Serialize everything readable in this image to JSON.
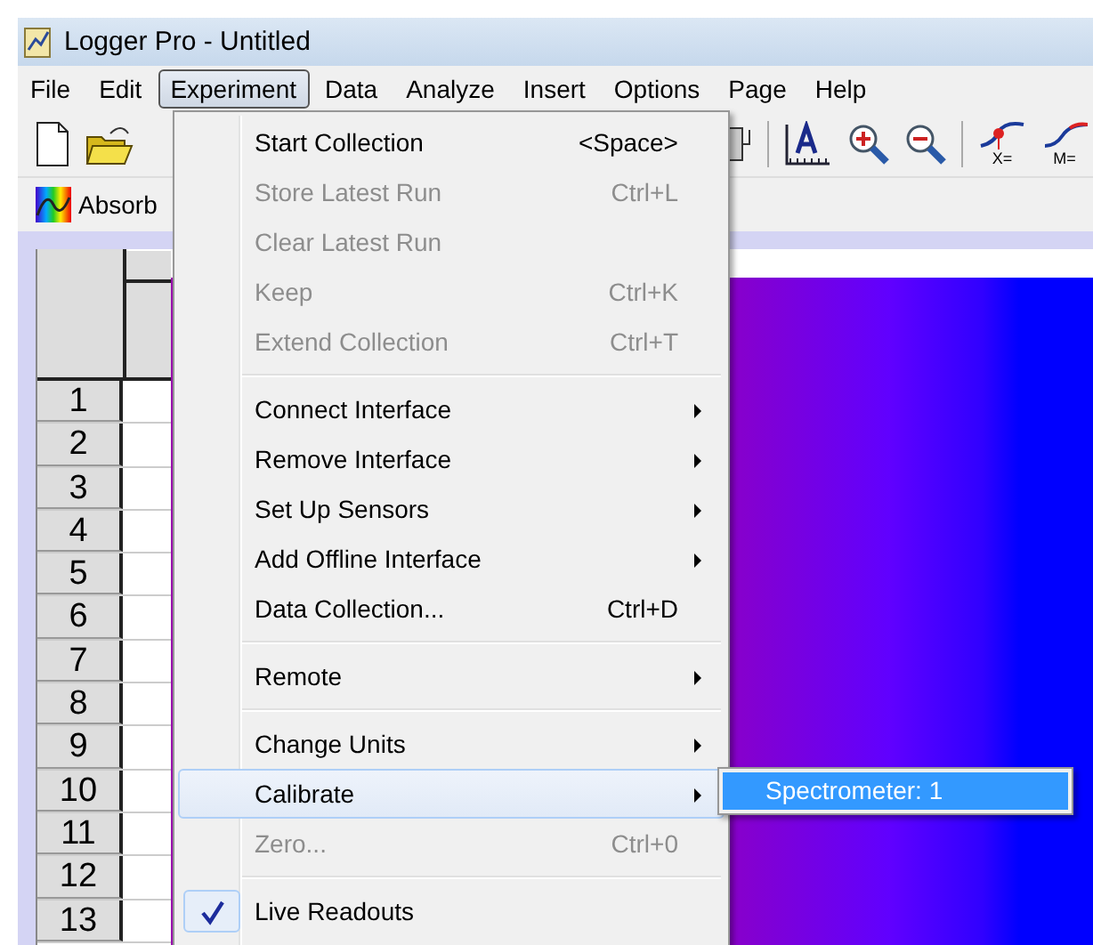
{
  "window": {
    "title": "Logger Pro - Untitled"
  },
  "menubar": [
    {
      "label": "File",
      "selected": false
    },
    {
      "label": "Edit",
      "selected": false
    },
    {
      "label": "Experiment",
      "selected": true
    },
    {
      "label": "Data",
      "selected": false
    },
    {
      "label": "Analyze",
      "selected": false
    },
    {
      "label": "Insert",
      "selected": false
    },
    {
      "label": "Options",
      "selected": false
    },
    {
      "label": "Page",
      "selected": false
    },
    {
      "label": "Help",
      "selected": false
    }
  ],
  "toolbar": {
    "tangent_label": "X=",
    "model_label": "M="
  },
  "toolbar2": {
    "button": "Absorb"
  },
  "table": {
    "rows": [
      "1",
      "2",
      "3",
      "4",
      "5",
      "6",
      "7",
      "8",
      "9",
      "10",
      "11",
      "12",
      "13"
    ]
  },
  "menu": [
    {
      "kind": "item",
      "label": "Start Collection",
      "shortcut": "<Space>",
      "disabled": false,
      "submenu": false,
      "checked": false,
      "selected": false
    },
    {
      "kind": "item",
      "label": "Store Latest Run",
      "shortcut": "Ctrl+L",
      "disabled": true,
      "submenu": false,
      "checked": false,
      "selected": false
    },
    {
      "kind": "item",
      "label": "Clear Latest Run",
      "disabled": true,
      "submenu": false,
      "checked": false,
      "selected": false
    },
    {
      "kind": "item",
      "label": "Keep",
      "shortcut": "Ctrl+K",
      "disabled": true,
      "submenu": false,
      "checked": false,
      "selected": false
    },
    {
      "kind": "item",
      "label": "Extend Collection",
      "shortcut": "Ctrl+T",
      "disabled": true,
      "submenu": false,
      "checked": false,
      "selected": false
    },
    {
      "kind": "separator"
    },
    {
      "kind": "item",
      "label": "Connect Interface",
      "disabled": false,
      "submenu": true,
      "checked": false,
      "selected": false
    },
    {
      "kind": "item",
      "label": "Remove Interface",
      "disabled": false,
      "submenu": true,
      "checked": false,
      "selected": false
    },
    {
      "kind": "item",
      "label": "Set Up Sensors",
      "disabled": false,
      "submenu": true,
      "checked": false,
      "selected": false
    },
    {
      "kind": "item",
      "label": "Add Offline Interface",
      "disabled": false,
      "submenu": true,
      "checked": false,
      "selected": false
    },
    {
      "kind": "item",
      "label": "Data Collection...",
      "shortcut": "Ctrl+D",
      "disabled": false,
      "submenu": false,
      "checked": false,
      "selected": false
    },
    {
      "kind": "separator"
    },
    {
      "kind": "item",
      "label": "Remote",
      "disabled": false,
      "submenu": true,
      "checked": false,
      "selected": false
    },
    {
      "kind": "separator"
    },
    {
      "kind": "item",
      "label": "Change Units",
      "disabled": false,
      "submenu": true,
      "checked": false,
      "selected": false
    },
    {
      "kind": "item",
      "label": "Calibrate",
      "disabled": false,
      "submenu": true,
      "checked": false,
      "selected": true
    },
    {
      "kind": "item",
      "label": "Zero...",
      "shortcut": "Ctrl+0",
      "disabled": true,
      "submenu": false,
      "checked": false,
      "selected": false
    },
    {
      "kind": "separator"
    },
    {
      "kind": "item",
      "label": "Live Readouts",
      "disabled": false,
      "submenu": false,
      "checked": true,
      "selected": false
    }
  ],
  "submenu": [
    {
      "label": "Spectrometer: 1",
      "selected": true
    }
  ]
}
